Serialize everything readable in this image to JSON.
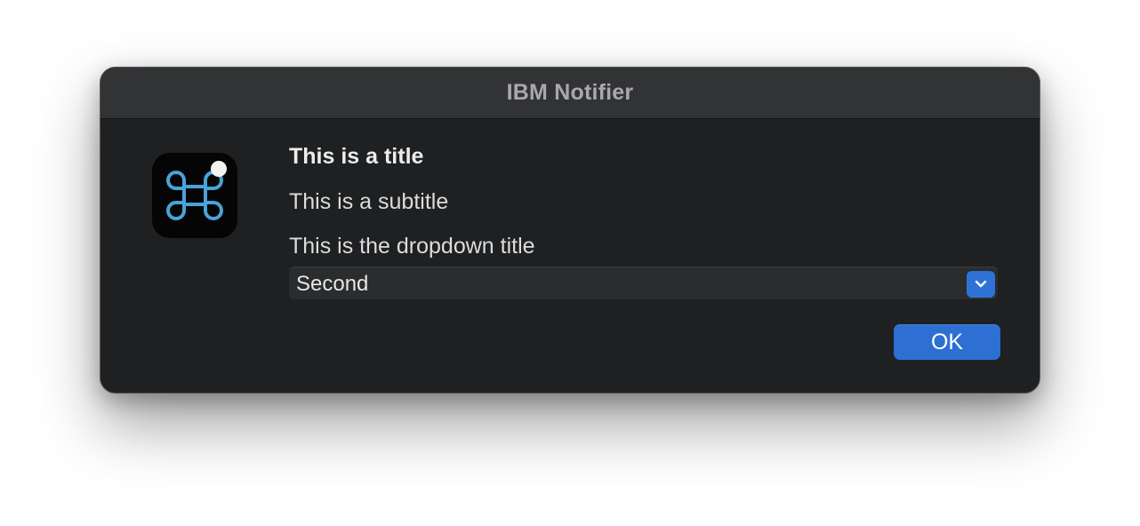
{
  "window": {
    "title": "IBM Notifier"
  },
  "app_icon": {
    "icon": "command-key-icon",
    "badge": "notification-dot-icon"
  },
  "content": {
    "title": "This is a title",
    "subtitle": "This is a subtitle",
    "dropdown_title": "This is the dropdown title",
    "dropdown": {
      "selected": "Second",
      "arrow_icon": "chevron-down-icon"
    }
  },
  "buttons": {
    "ok_label": "OK"
  },
  "colors": {
    "window_bg": "#1e2022",
    "titlebar_bg": "#323335",
    "accent": "#2d6fd3",
    "icon_stroke": "#4aa3d8"
  }
}
